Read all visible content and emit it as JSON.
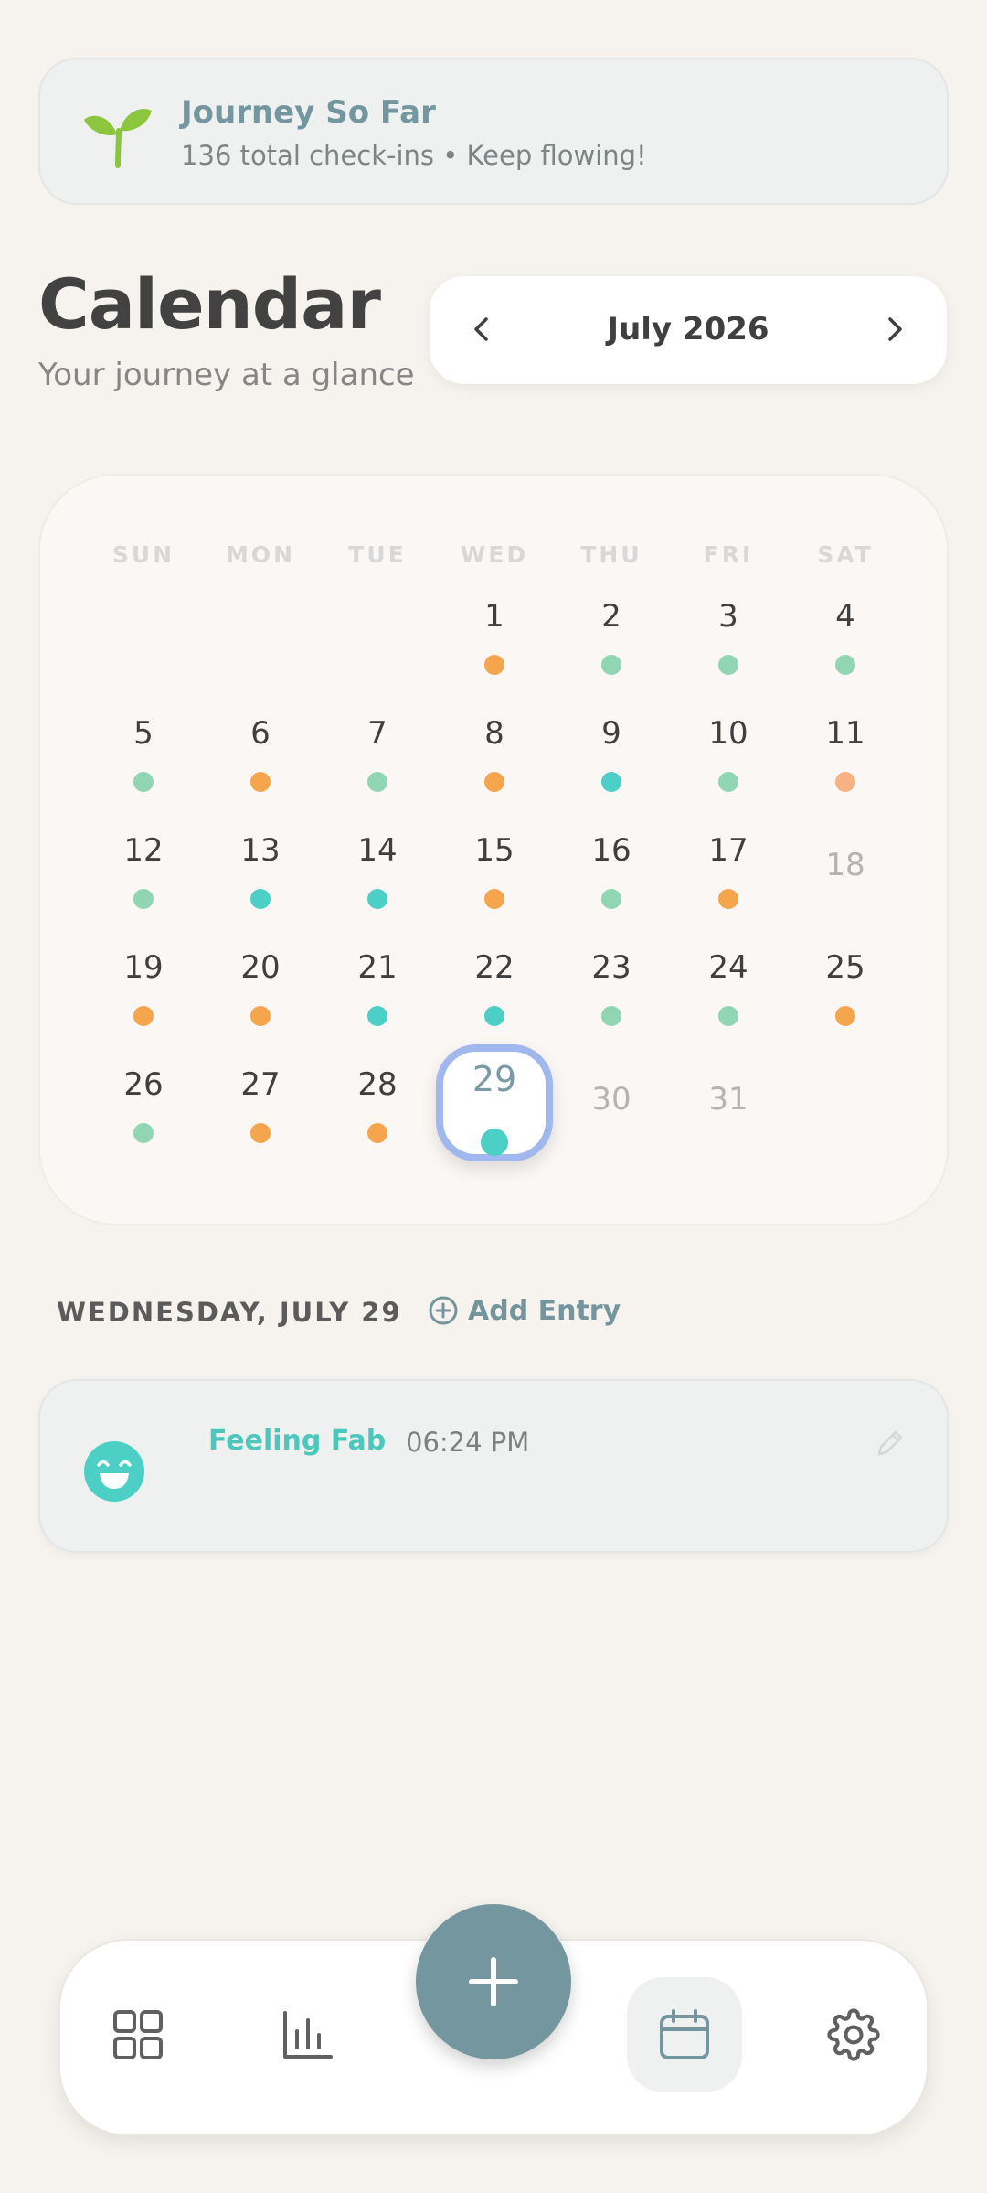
{
  "journey": {
    "title": "Journey So Far",
    "subtitle": "136 total check-ins • Keep flowing!",
    "icon": "sprout-icon"
  },
  "header": {
    "title": "Calendar",
    "subtitle": "Your journey at a glance",
    "month": "July 2026",
    "prev_icon": "chevron-left-icon",
    "next_icon": "chevron-right-icon"
  },
  "colors": {
    "orange": "#f6a54d",
    "green": "#90d6b3",
    "teal": "#4ccfc4",
    "peach": "#f7b184",
    "accent": "#74979f",
    "selected_ring": "#a1b8ee"
  },
  "calendar": {
    "weekdays": [
      "SUN",
      "MON",
      "TUE",
      "WED",
      "THU",
      "FRI",
      "SAT"
    ],
    "first_weekday_index": 3,
    "selected_day": 29,
    "days": [
      {
        "d": "1",
        "mood": "orange"
      },
      {
        "d": "2",
        "mood": "green"
      },
      {
        "d": "3",
        "mood": "green"
      },
      {
        "d": "4",
        "mood": "green"
      },
      {
        "d": "5",
        "mood": "green"
      },
      {
        "d": "6",
        "mood": "orange"
      },
      {
        "d": "7",
        "mood": "green"
      },
      {
        "d": "8",
        "mood": "orange"
      },
      {
        "d": "9",
        "mood": "teal"
      },
      {
        "d": "10",
        "mood": "green"
      },
      {
        "d": "11",
        "mood": "peach"
      },
      {
        "d": "12",
        "mood": "green"
      },
      {
        "d": "13",
        "mood": "teal"
      },
      {
        "d": "14",
        "mood": "teal"
      },
      {
        "d": "15",
        "mood": "orange"
      },
      {
        "d": "16",
        "mood": "green"
      },
      {
        "d": "17",
        "mood": "orange"
      },
      {
        "d": "18",
        "mood": null
      },
      {
        "d": "19",
        "mood": "orange"
      },
      {
        "d": "20",
        "mood": "orange"
      },
      {
        "d": "21",
        "mood": "teal"
      },
      {
        "d": "22",
        "mood": "teal"
      },
      {
        "d": "23",
        "mood": "green"
      },
      {
        "d": "24",
        "mood": "green"
      },
      {
        "d": "25",
        "mood": "orange"
      },
      {
        "d": "26",
        "mood": "green"
      },
      {
        "d": "27",
        "mood": "orange"
      },
      {
        "d": "28",
        "mood": "orange"
      },
      {
        "d": "29",
        "mood": "teal"
      },
      {
        "d": "30",
        "mood": null
      },
      {
        "d": "31",
        "mood": null
      }
    ]
  },
  "day_detail": {
    "heading": "WEDNESDAY, JULY 29",
    "add_label": "Add Entry",
    "entries": [
      {
        "mood": "Feeling Fab",
        "time": "06:24 PM",
        "icon": "grin-face-icon"
      }
    ]
  },
  "nav": {
    "items": [
      "dashboard-icon",
      "stats-icon",
      "calendar-icon",
      "settings-icon"
    ],
    "active": "calendar-icon",
    "fab_icon": "plus-icon"
  }
}
